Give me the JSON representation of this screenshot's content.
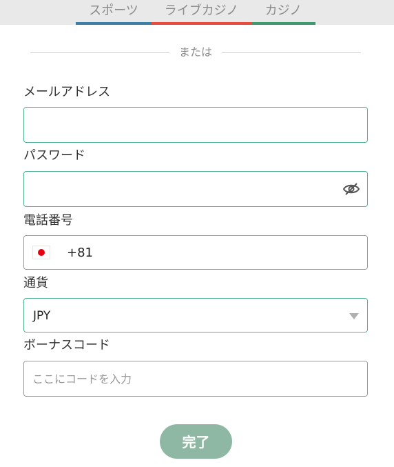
{
  "tabs": [
    {
      "label": "スポーツ",
      "color": "#3d7fa6"
    },
    {
      "label": "ライブカジノ",
      "color": "#e84c3d"
    },
    {
      "label": "カジノ",
      "color": "#3e9a6e"
    }
  ],
  "divider": {
    "text": "または"
  },
  "email": {
    "label": "メールアドレス",
    "value": ""
  },
  "password": {
    "label": "パスワード",
    "value": "",
    "icon": "eye-slash-icon"
  },
  "phone": {
    "label": "電話番号",
    "country_code": "+81",
    "flag": "japan-flag-icon"
  },
  "currency": {
    "label": "通貨",
    "selected": "JPY"
  },
  "bonus": {
    "label": "ボーナスコード",
    "placeholder": "ここにコードを入力"
  },
  "submit": {
    "label": "完了"
  },
  "colors": {
    "accent": "#4fb38f",
    "button": "#8fb8a4"
  }
}
